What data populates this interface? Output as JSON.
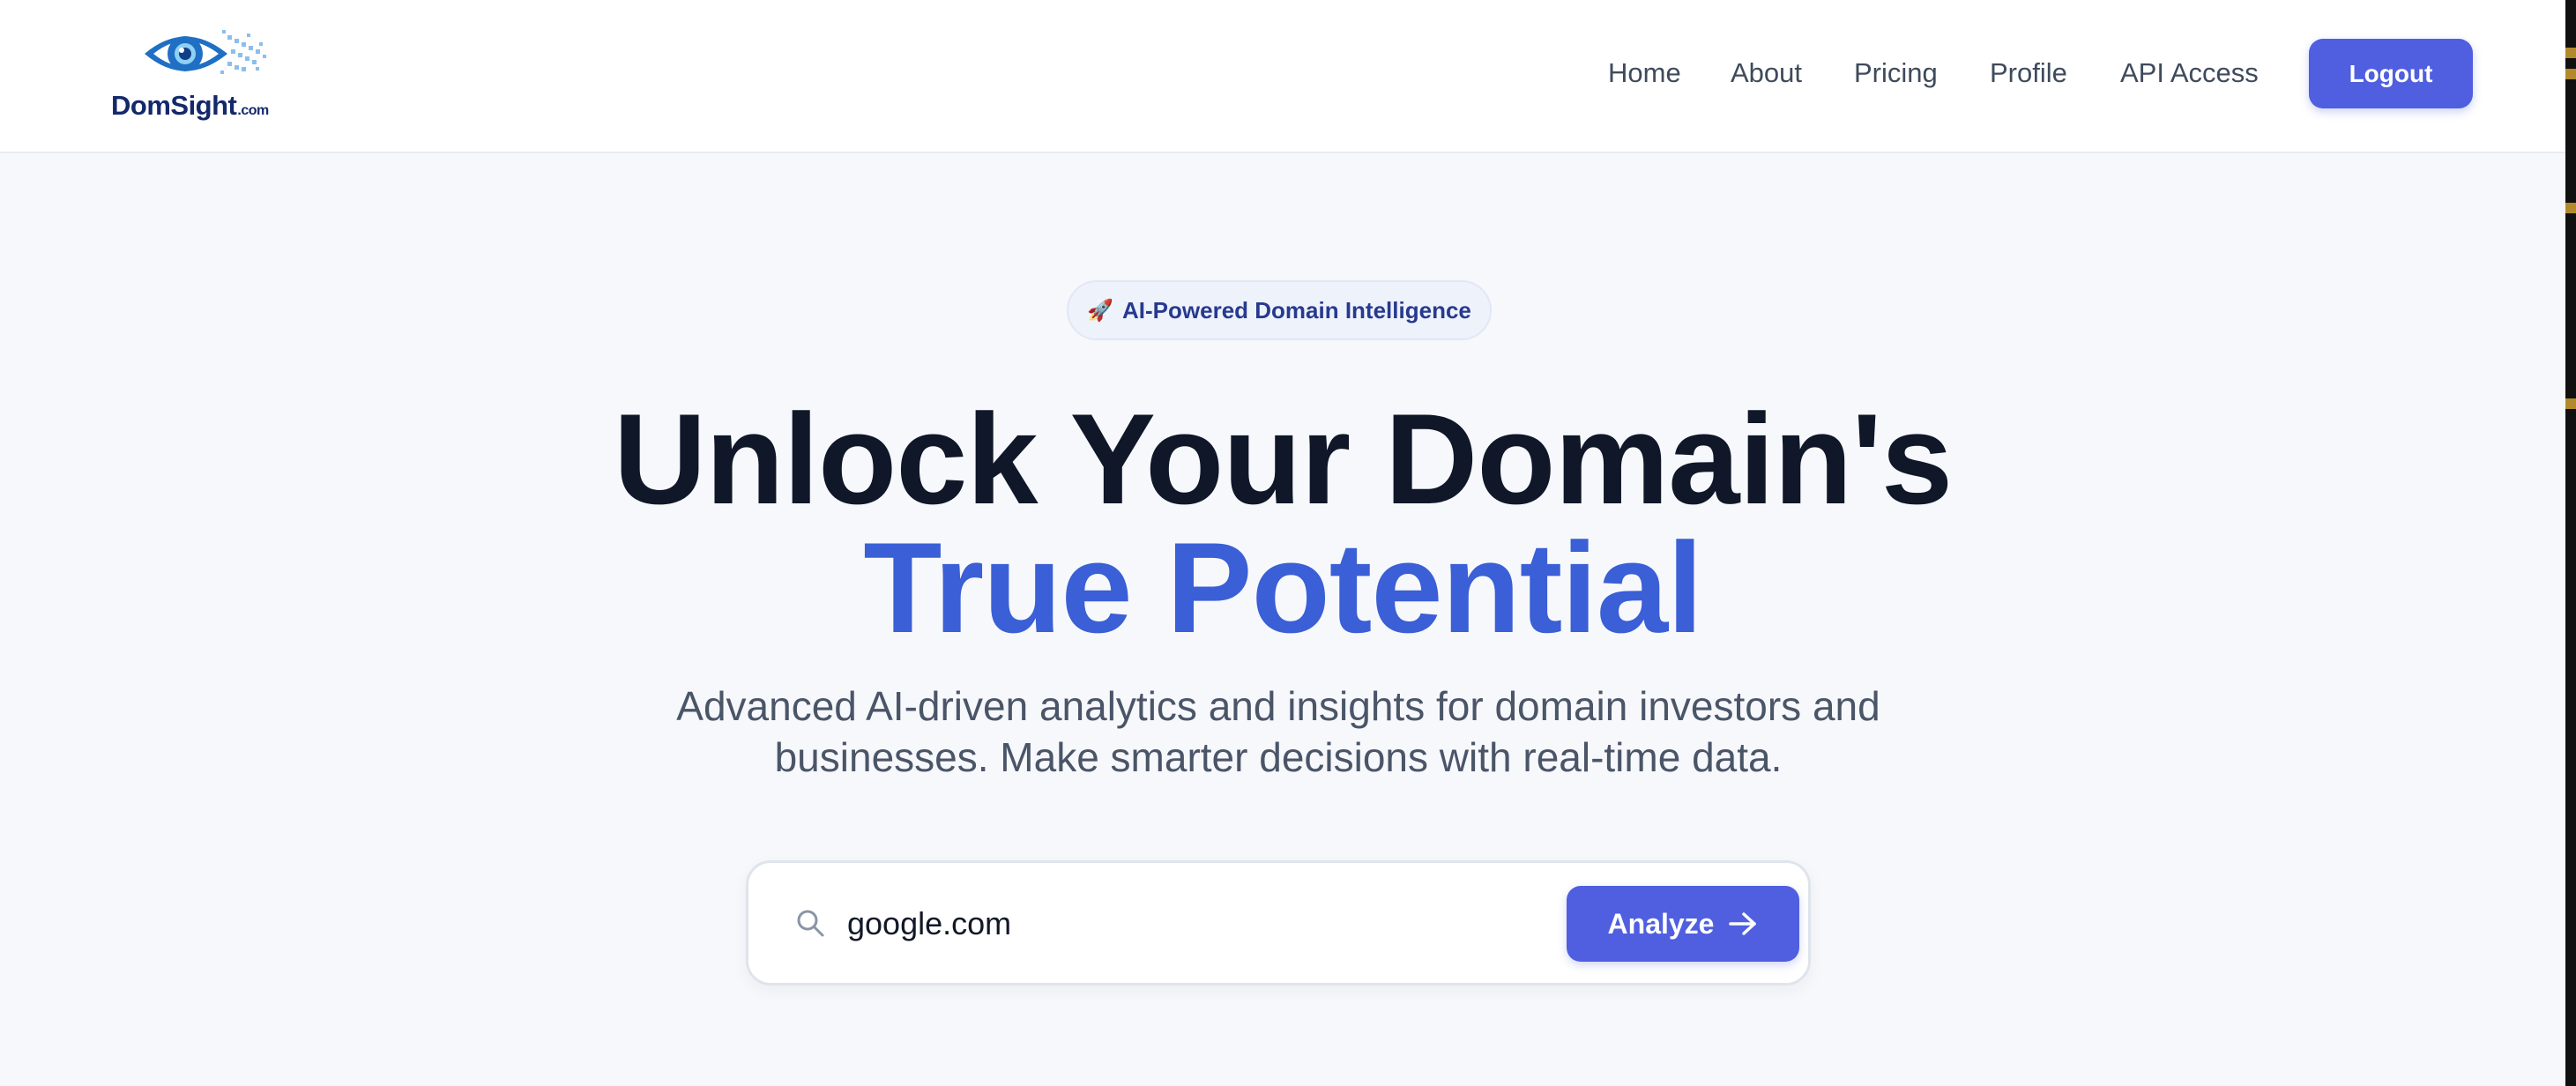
{
  "logo": {
    "name": "DomSight",
    "tld": ".com"
  },
  "nav": {
    "items": [
      {
        "label": "Home"
      },
      {
        "label": "About"
      },
      {
        "label": "Pricing"
      },
      {
        "label": "Profile"
      },
      {
        "label": "API Access"
      }
    ],
    "logout_label": "Logout"
  },
  "hero": {
    "badge_icon": "rocket-icon",
    "badge_text": "AI-Powered Domain Intelligence",
    "title_line1": "Unlock Your Domain's",
    "title_line2": "True Potential",
    "subtitle": "Advanced AI-driven analytics and insights for domain investors and businesses. Make smarter decisions with real-time data."
  },
  "search": {
    "icon": "search-icon",
    "value": "google.com",
    "button_label": "Analyze",
    "button_icon": "arrow-right-icon"
  },
  "colors": {
    "accent": "#4f5fe0",
    "title_dark": "#0f1729",
    "title_blue": "#3a5fd6",
    "logo_navy": "#14296b"
  }
}
